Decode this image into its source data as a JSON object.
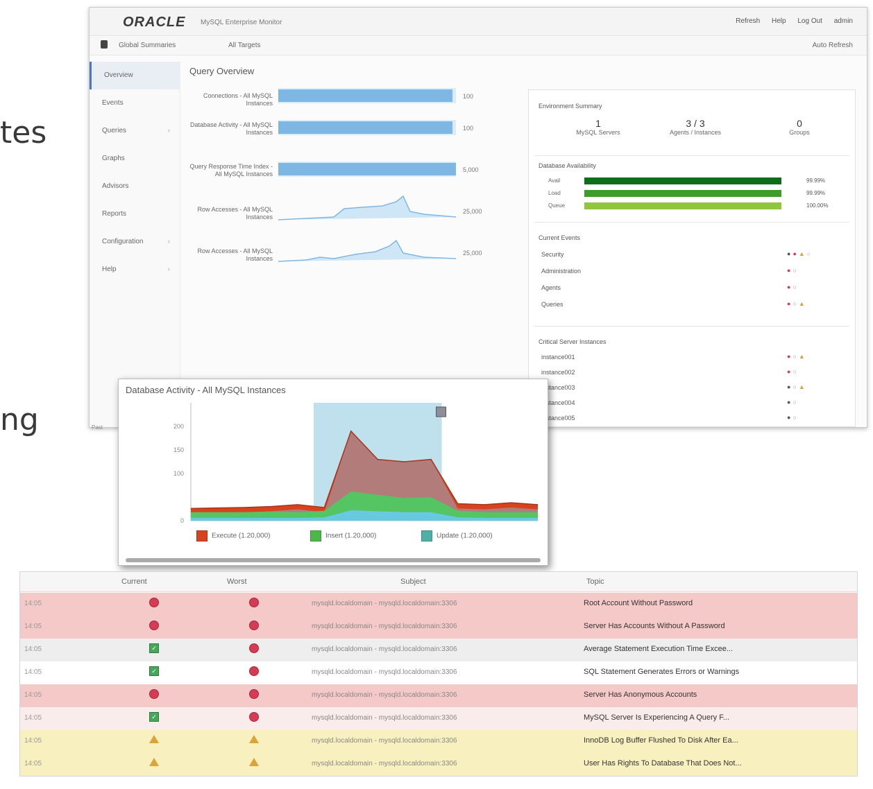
{
  "slide": {
    "word1": "tes",
    "word2": "ng"
  },
  "app": {
    "logo": "ORACLE",
    "subtitle": "MySQL Enterprise Monitor",
    "top_links": [
      "Refresh",
      "Help",
      "Log Out",
      "admin"
    ],
    "nav_left": "Global Summaries",
    "nav_mid": "All Targets",
    "nav_right": "Auto Refresh"
  },
  "sidebar": {
    "items": [
      {
        "label": "Overview"
      },
      {
        "label": "Events"
      },
      {
        "label": "Queries"
      },
      {
        "label": "Graphs"
      },
      {
        "label": "Advisors"
      },
      {
        "label": "Reports"
      },
      {
        "label": "Configuration"
      },
      {
        "label": "Help"
      }
    ]
  },
  "main": {
    "panel_title": "Query Overview",
    "rows": [
      {
        "label": "Connections - All MySQL Instances",
        "value": "100",
        "fill_pct": 0.98
      },
      {
        "label": "Database Activity - All MySQL Instances",
        "value": "100",
        "fill_pct": 0.98
      },
      {
        "label": "Query Response Time Index - All MySQL Instances",
        "value": "5,000",
        "fill_pct": 1.0
      },
      {
        "label": "Row Accesses - All MySQL Instances",
        "value": "25,000",
        "fill_pct": 0
      },
      {
        "label": "Row Accesses - All MySQL Instances",
        "value": "25,000",
        "fill_pct": 0
      }
    ]
  },
  "right_panel": {
    "summary_title": "Environment Summary",
    "stats": [
      {
        "value": "1",
        "label": "MySQL Servers"
      },
      {
        "value": "3 / 3",
        "label": "Agents / Instances"
      },
      {
        "value": "0",
        "label": "Groups"
      }
    ],
    "health_title": "Database Availability",
    "health_bars": [
      {
        "label": "Avail",
        "value": "99.99%",
        "fill_pct": 1.0,
        "color": "#0f6e1c"
      },
      {
        "label": "Load",
        "value": "99.99%",
        "fill_pct": 1.0,
        "color": "#3e9c2b"
      },
      {
        "label": "Queue",
        "value": "100.00%",
        "fill_pct": 1.0,
        "color": "#8fc63d"
      }
    ],
    "emergent_title": "Current Events",
    "emergent": [
      {
        "label": "Security"
      },
      {
        "label": "Administration"
      },
      {
        "label": "Agents"
      },
      {
        "label": "Queries"
      }
    ],
    "instances_title": "Critical Server Instances",
    "instances": [
      {
        "label": "instance001"
      },
      {
        "label": "instance002"
      },
      {
        "label": "instance003"
      },
      {
        "label": "instance004"
      },
      {
        "label": "instance005"
      }
    ]
  },
  "chart_popup": {
    "title": "Database Activity - All MySQL Instances",
    "side_label": "Past",
    "y_ticks": [
      "200",
      "150",
      "100",
      "0"
    ],
    "legend": [
      {
        "label": "Execute (1.20,000)",
        "color": "#d8431f"
      },
      {
        "label": "Insert (1.20,000)",
        "color": "#4db84a"
      },
      {
        "label": "Update (1.20,000)",
        "color": "#4fb0a7"
      }
    ],
    "colors": {
      "base": "#b27c7a",
      "red": "#d8431f",
      "green": "#55c463",
      "teal": "#69c9e0",
      "select": "#bfe1ee"
    }
  },
  "chart_data": {
    "type": "area",
    "title": "Database Activity - All MySQL Instances",
    "x": [
      0,
      1,
      2,
      3,
      4,
      5,
      6,
      7,
      8,
      9,
      10,
      11,
      12,
      13
    ],
    "ylim": [
      0,
      250
    ],
    "series": [
      {
        "name": "Execute (1.20,000)",
        "values": [
          26,
          27,
          28,
          30,
          34,
          28,
          190,
          130,
          125,
          130,
          36,
          34,
          38,
          34
        ]
      },
      {
        "name": "Insert (1.20,000)",
        "values": [
          12,
          12,
          12,
          13,
          12,
          14,
          40,
          35,
          30,
          32,
          14,
          12,
          12,
          12
        ]
      },
      {
        "name": "Update (1.20,000)",
        "values": [
          6,
          6,
          6,
          6,
          6,
          7,
          22,
          20,
          18,
          18,
          7,
          6,
          6,
          6
        ]
      }
    ]
  },
  "alerts": {
    "headers": [
      "Current",
      "Worst",
      "Subject",
      "Topic"
    ],
    "rows": [
      {
        "time": "14:05",
        "current": "alert",
        "worst": "alert",
        "target": "mysqld.localdomain - mysqld.localdomain:3306",
        "name": "Root Account Without Password",
        "bg": "#f6c9c9"
      },
      {
        "time": "14:05",
        "current": "alert",
        "worst": "alert",
        "target": "mysqld.localdomain - mysqld.localdomain:3306",
        "name": "Server Has Accounts Without A Password",
        "bg": "#f6c9c9"
      },
      {
        "time": "14:05",
        "current": "ok",
        "worst": "alert",
        "target": "mysqld.localdomain - mysqld.localdomain:3306",
        "name": "Average Statement Execution Time Excee...",
        "bg": "#eeeeee"
      },
      {
        "time": "14:05",
        "current": "ok",
        "worst": "alert",
        "target": "mysqld.localdomain - mysqld.localdomain:3306",
        "name": "SQL Statement Generates Errors or Warnings",
        "bg": "#ffffff"
      },
      {
        "time": "14:05",
        "current": "alert",
        "worst": "alert",
        "target": "mysqld.localdomain - mysqld.localdomain:3306",
        "name": "Server Has Anonymous Accounts",
        "bg": "#f6c9c9"
      },
      {
        "time": "14:05",
        "current": "ok",
        "worst": "alert",
        "target": "mysqld.localdomain - mysqld.localdomain:3306",
        "name": "MySQL Server Is Experiencing A Query F...",
        "bg": "#fbecec"
      },
      {
        "time": "14:05",
        "current": "warn",
        "worst": "warn",
        "target": "mysqld.localdomain - mysqld.localdomain:3306",
        "name": "InnoDB Log Buffer Flushed To Disk After Ea...",
        "bg": "#f8f0bf"
      },
      {
        "time": "14:05",
        "current": "warn",
        "worst": "warn",
        "target": "mysqld.localdomain - mysqld.localdomain:3306",
        "name": "User Has Rights To Database That Does Not...",
        "bg": "#f8f0bf"
      }
    ]
  }
}
